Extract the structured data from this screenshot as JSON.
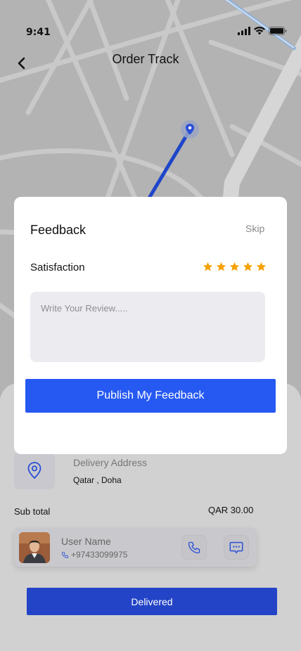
{
  "status_bar": {
    "time": "9:41"
  },
  "header": {
    "title": "Order Track"
  },
  "feedback_modal": {
    "title": "Feedback",
    "skip_label": "Skip",
    "satisfaction_label": "Satisfaction",
    "rating": 5,
    "rating_max": 5,
    "review_placeholder": "Write Your Review.....",
    "review_value": "",
    "publish_label": "Publish My Feedback"
  },
  "delivery": {
    "address_label": "Delivery Address",
    "address_value": "Qatar , Doha"
  },
  "order": {
    "subtotal_label": "Sub total",
    "subtotal_value": "QAR 30.00"
  },
  "courier": {
    "name": "User Name",
    "phone": "+97433099975"
  },
  "status_button": {
    "label": "Delivered"
  },
  "colors": {
    "accent": "#2659f2",
    "status_button": "#2344c6",
    "star": "#f5a20a",
    "route": "#1f45c9"
  },
  "icons": [
    "back-arrow-icon",
    "location-pin-icon",
    "star-icon",
    "phone-icon",
    "chat-icon",
    "signal-icon",
    "wifi-icon",
    "battery-icon"
  ]
}
